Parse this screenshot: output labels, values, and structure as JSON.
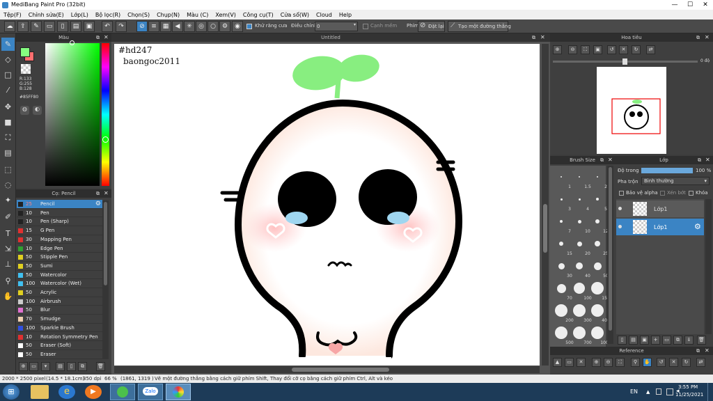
{
  "window": {
    "title": "MediBang Paint Pro (32bit)",
    "minimize": "—",
    "maximize": "☐",
    "close": "✕"
  },
  "menu": [
    "Tệp(F)",
    "Chỉnh sửa(E)",
    "Lớp(L)",
    "Bộ lọc(R)",
    "Chọn(S)",
    "Chụp(N)",
    "Màu (C)",
    "Xem(V)",
    "Công cụ(T)",
    "Cửa sổ(W)",
    "Cloud",
    "Help"
  ],
  "toolbar": {
    "antialias_label": "Khử răng cưa",
    "adjust_label": "Điều chỉnh",
    "adjust_value": "0",
    "soft_edge_label": "Cạnh mềm",
    "key_label": "Phím",
    "reset_label": "Đặt lại",
    "straight_line_label": "Tạo một đường thẳng"
  },
  "color_panel": {
    "title": "Màu",
    "r": "R:133",
    "g": "G:255",
    "b": "B:128",
    "hex": "#85FF80",
    "fg_color": "#85ff80",
    "bg_color": "#ff7070"
  },
  "brush_panel": {
    "title": "Cọ: Pencil",
    "brushes": [
      {
        "size": "25",
        "name": "Pencil",
        "color": "#222222",
        "selected": true
      },
      {
        "size": "10",
        "name": "Pen",
        "color": "#222222"
      },
      {
        "size": "10",
        "name": "Pen (Sharp)",
        "color": "#222222"
      },
      {
        "size": "15",
        "name": "G Pen",
        "color": "#e03030"
      },
      {
        "size": "30",
        "name": "Mapping Pen",
        "color": "#e03030"
      },
      {
        "size": "10",
        "name": "Edge Pen",
        "color": "#30a030"
      },
      {
        "size": "50",
        "name": "Stipple Pen",
        "color": "#e0d020"
      },
      {
        "size": "50",
        "name": "Sumi",
        "color": "#e0d020"
      },
      {
        "size": "50",
        "name": "Watercolor",
        "color": "#40c0f0"
      },
      {
        "size": "100",
        "name": "Watercolor (Wet)",
        "color": "#40c0f0"
      },
      {
        "size": "50",
        "name": "Acrylic",
        "color": "#e0d020"
      },
      {
        "size": "100",
        "name": "Airbrush",
        "color": "#cccccc"
      },
      {
        "size": "50",
        "name": "Blur",
        "color": "#e070d0"
      },
      {
        "size": "70",
        "name": "Smudge",
        "color": "#f0d0b0"
      },
      {
        "size": "100",
        "name": "Sparkle Brush",
        "color": "#3050e0"
      },
      {
        "size": "10",
        "name": "Rotation Symmetry Pen",
        "color": "#e03030"
      },
      {
        "size": "50",
        "name": "Eraser (Soft)",
        "color": "#ffffff"
      },
      {
        "size": "50",
        "name": "Eraser",
        "color": "#ffffff"
      }
    ]
  },
  "canvas": {
    "tab_title": "Untitled",
    "text_line1": "#hd247",
    "text_line2": "baongoc2011"
  },
  "navigator": {
    "title": "Hoa tiêu",
    "rotation": "0 độ"
  },
  "brush_size": {
    "title": "Brush Size",
    "sizes": [
      "1",
      "1.5",
      "2",
      "3",
      "4",
      "5",
      "7",
      "10",
      "12",
      "15",
      "20",
      "25",
      "30",
      "40",
      "50",
      "70",
      "100",
      "150",
      "200",
      "300",
      "400",
      "500",
      "700",
      "1000"
    ]
  },
  "layer_panel": {
    "title": "Lớp",
    "opacity_label": "Độ trong",
    "opacity_value": "100 %",
    "opacity_level": 1.0,
    "blend_label": "Pha trộn",
    "blend_value": "Bình thường",
    "protect_alpha": "Bảo vệ alpha",
    "clipping": "Xén bớt",
    "lock": "Khóa",
    "layers": [
      {
        "name": "Lớp1",
        "selected": false
      },
      {
        "name": "Lớp1",
        "selected": true
      }
    ]
  },
  "reference": {
    "title": "Reference"
  },
  "status": {
    "size": "2000 * 2500 pixel",
    "physical": "(14.5 * 18.1cm)",
    "dpi": "350 dpi",
    "zoom": "66 %",
    "coords": "(1861, 1319 )",
    "hint": "Vẽ một đường thẳng bằng cách giữ phím Shift, Thay đổi cỡ cọ bằng cách giữ phím Ctrl, Alt và kéo"
  },
  "taskbar": {
    "lang": "EN",
    "time": "3:55 PM",
    "date": "11/25/2021",
    "zalo": "Zalo"
  }
}
